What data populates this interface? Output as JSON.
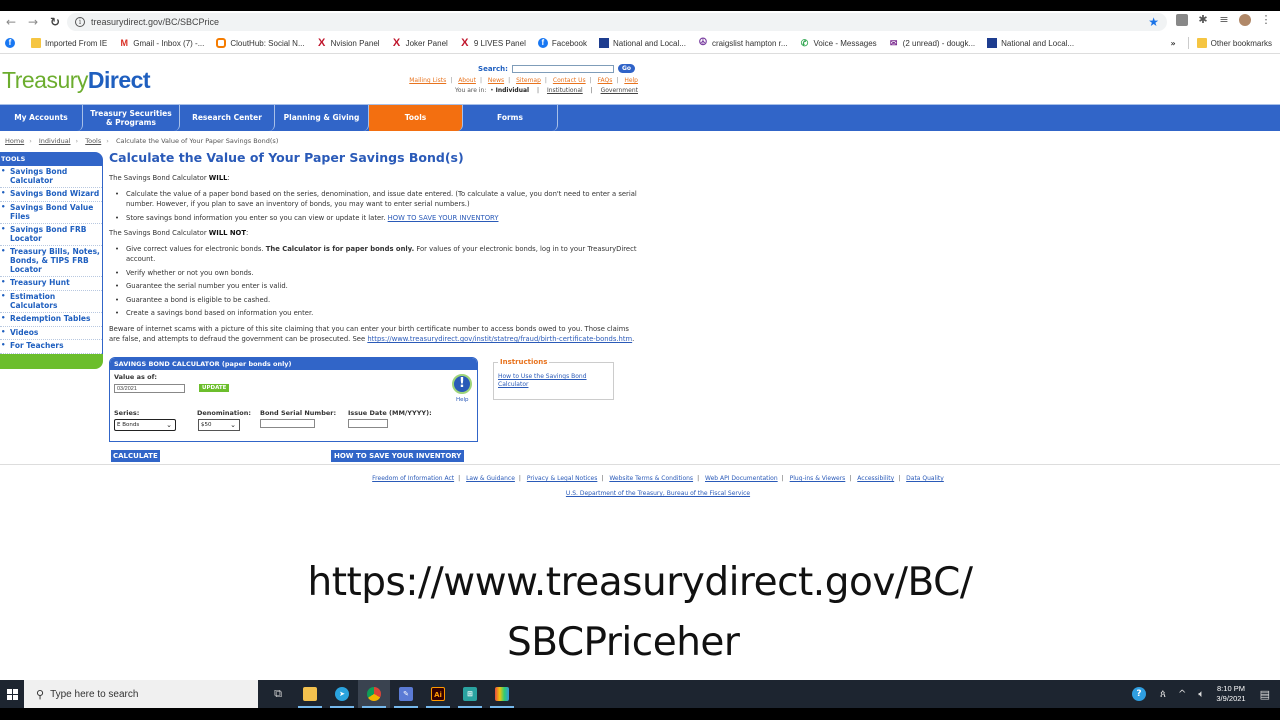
{
  "browser": {
    "url": "treasurydirect.gov/BC/SBCPrice",
    "bookmarks": [
      {
        "label": "Imported From IE",
        "icon": "folder-icon"
      },
      {
        "label": "Gmail - Inbox (7) -...",
        "icon": "gmail-icon"
      },
      {
        "label": "CloutHub: Social N...",
        "icon": "clouthub-icon"
      },
      {
        "label": "Nvision Panel",
        "icon": "x-icon"
      },
      {
        "label": "Joker Panel",
        "icon": "x-icon"
      },
      {
        "label": "9 LIVES Panel",
        "icon": "x-icon"
      },
      {
        "label": "Facebook",
        "icon": "facebook-icon"
      },
      {
        "label": "National and Local...",
        "icon": "news-icon"
      },
      {
        "label": "craigslist hampton r...",
        "icon": "peace-icon"
      },
      {
        "label": "Voice - Messages",
        "icon": "phone-icon"
      },
      {
        "label": "(2 unread) - dougk...",
        "icon": "mail-icon"
      },
      {
        "label": "National and Local...",
        "icon": "news-icon"
      }
    ],
    "overflow": "»",
    "other_bookmarks": "Other bookmarks"
  },
  "site": {
    "logo_part1": "Treasury",
    "logo_part2": "Direct",
    "search_label": "Search:",
    "search_value": "",
    "go_label": "Go",
    "util_links": [
      "Mailing Lists",
      "About",
      "News",
      "Sitemap",
      "Contact Us",
      "FAQs",
      "Help"
    ],
    "you_are_in_label": "You are in:",
    "audience_current": "Individual",
    "audience_links": [
      "Institutional",
      "Government"
    ],
    "nav": [
      {
        "label": "My Accounts",
        "active": false
      },
      {
        "label": "Treasury Securities & Programs",
        "active": false
      },
      {
        "label": "Research Center",
        "active": false
      },
      {
        "label": "Planning & Giving",
        "active": false
      },
      {
        "label": "Tools",
        "active": true
      },
      {
        "label": "Forms",
        "active": false
      }
    ],
    "breadcrumb": [
      "Home",
      "Individual",
      "Tools",
      "Calculate the Value of Your Paper Savings Bond(s)"
    ]
  },
  "sidebar": {
    "heading": "TOOLS",
    "items": [
      "Savings Bond Calculator",
      "Savings Bond Wizard",
      "Savings Bond Value Files",
      "Savings Bond FRB Locator",
      "Treasury Bills, Notes, Bonds, & TIPS FRB Locator",
      "Treasury Hunt",
      "Estimation Calculators",
      "Redemption Tables",
      "Videos",
      "For Teachers"
    ]
  },
  "main": {
    "title": "Calculate the Value of Your Paper Savings Bond(s)",
    "will_intro": "The Savings Bond Calculator ",
    "will_bold": "WILL",
    "will_items": [
      "Calculate the value of a paper bond based on the series, denomination, and issue date entered. (To calculate a value, you don't need to enter a serial number. However, if you plan to save an inventory of bonds, you may want to enter serial numbers.)",
      "Store savings bond information you enter so you can view or update it later. "
    ],
    "will_link": "HOW TO SAVE YOUR INVENTORY",
    "willnot_intro": "The Savings Bond Calculator ",
    "willnot_bold": "WILL NOT",
    "willnot_first_pre": "Give correct values for electronic bonds. ",
    "willnot_first_bold": "The Calculator is for paper bonds only.",
    "willnot_first_post": " For values of your electronic bonds, log in to your TreasuryDirect account.",
    "willnot_items": [
      "Verify whether or not you own bonds.",
      "Guarantee the serial number you enter is valid.",
      "Guarantee a bond is eligible to be cashed.",
      "Create a savings bond based on information you enter."
    ],
    "scam_text": "Beware of internet scams with a picture of this site claiming that you can enter your birth certificate number to access bonds owed to you. Those claims are false, and attempts to defraud the government can be prosecuted. See ",
    "scam_link": "https://www.treasurydirect.gov/instit/statreg/fraud/birth-certificate-bonds.htm",
    "scam_end": "."
  },
  "calculator": {
    "heading": "SAVINGS BOND CALCULATOR (paper bonds only)",
    "value_as_of_label": "Value as of:",
    "value_as_of": "03/2021",
    "update_label": "UPDATE",
    "help_label": "Help",
    "series_label": "Series:",
    "series_value": "E Bonds",
    "denomination_label": "Denomination:",
    "denomination_value": "$50",
    "serial_label": "Bond Serial Number:",
    "serial_value": "",
    "issue_date_label": "Issue Date (MM/YYYY):",
    "issue_date_value": "",
    "calculate_label": "CALCULATE",
    "save_inventory_label": "HOW TO SAVE YOUR INVENTORY"
  },
  "instructions": {
    "legend": "Instructions",
    "link": "How to Use the Savings Bond Calculator"
  },
  "footer": {
    "links": [
      "Freedom of Information Act",
      "Law & Guidance",
      "Privacy & Legal Notices",
      "Website Terms & Conditions",
      "Web API Documentation",
      "Plug-ins & Viewers",
      "Accessibility",
      "Data Quality"
    ],
    "agency": "U.S. Department of the Treasury, Bureau of the Fiscal Service"
  },
  "overlay": {
    "line1": "https://www.treasurydirect.gov/BC/",
    "line2": "SBCPriceher"
  },
  "taskbar": {
    "search_placeholder": "Type here to search",
    "time": "8:10 PM",
    "date": "3/9/2021"
  }
}
